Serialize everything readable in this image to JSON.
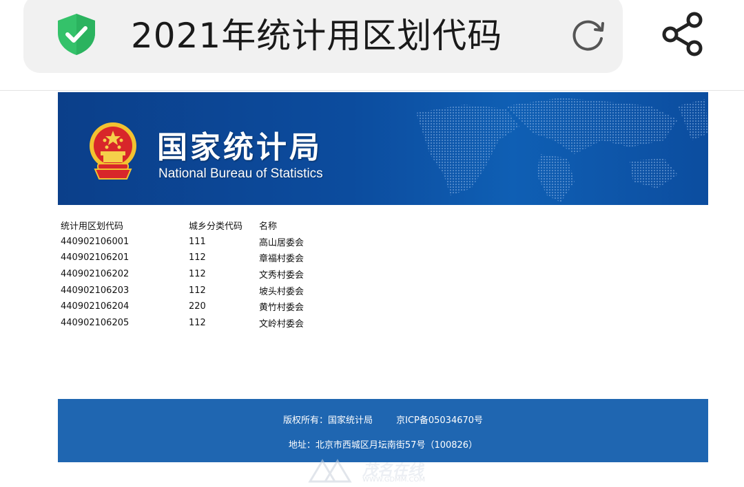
{
  "browser": {
    "title": "2021年统计用区划代码",
    "security_icon": "shield-check-icon",
    "reload_icon": "reload-icon",
    "share_icon": "share-icon",
    "colors": {
      "shield": "#34c26a",
      "bar_bg": "#f1f1f1"
    }
  },
  "banner": {
    "org_name_cn": "国家统计局",
    "org_name_en": "National Bureau of Statistics",
    "emblem_icon": "national-emblem-icon",
    "colors": {
      "bg_dark": "#0b3f8a",
      "bg_light": "#0f5fb4"
    }
  },
  "table": {
    "headers": [
      "统计用区划代码",
      "城乡分类代码",
      "名称"
    ],
    "rows": [
      [
        "440902106001",
        "111",
        "高山居委会"
      ],
      [
        "440902106201",
        "112",
        "章福村委会"
      ],
      [
        "440902106202",
        "112",
        "文秀村委会"
      ],
      [
        "440902106203",
        "112",
        "坡头村委会"
      ],
      [
        "440902106204",
        "220",
        "黄竹村委会"
      ],
      [
        "440902106205",
        "112",
        "文岭村委会"
      ]
    ]
  },
  "footer": {
    "copyright": "版权所有：国家统计局",
    "icp": "京ICP备05034670号",
    "address": "地址：北京市西城区月坛南街57号（100826）",
    "colors": {
      "bg": "#1f66b1"
    }
  },
  "watermark": {
    "text": "茂名在线",
    "url": "WWW.GDMM.COM"
  }
}
